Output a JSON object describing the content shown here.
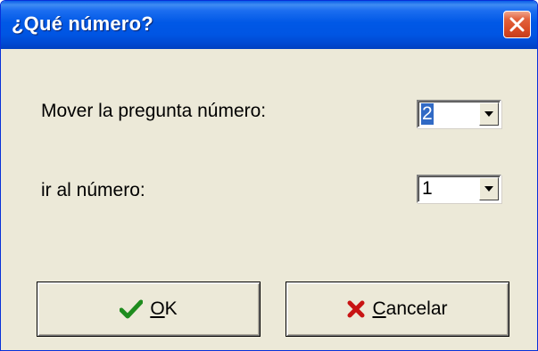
{
  "window": {
    "title": "¿Qué número?"
  },
  "form": {
    "move_label": "Mover la pregunta número:",
    "move_value": "2",
    "goto_label": "ir al número:",
    "goto_value": "1"
  },
  "buttons": {
    "ok_mnemonic": "O",
    "ok_rest": "K",
    "cancel_mnemonic": "C",
    "cancel_rest": "ancelar"
  },
  "icons": {
    "close": "close-x-icon",
    "ok": "checkmark-icon",
    "cancel": "red-x-icon",
    "dropdown": "chevron-down-icon"
  },
  "colors": {
    "titlebar": "#0058e6",
    "dialog_bg": "#ece9d8",
    "close_button": "#d84a24",
    "ok_check": "#1e8c1e",
    "cancel_x": "#c81414",
    "selection": "#316ac5"
  }
}
